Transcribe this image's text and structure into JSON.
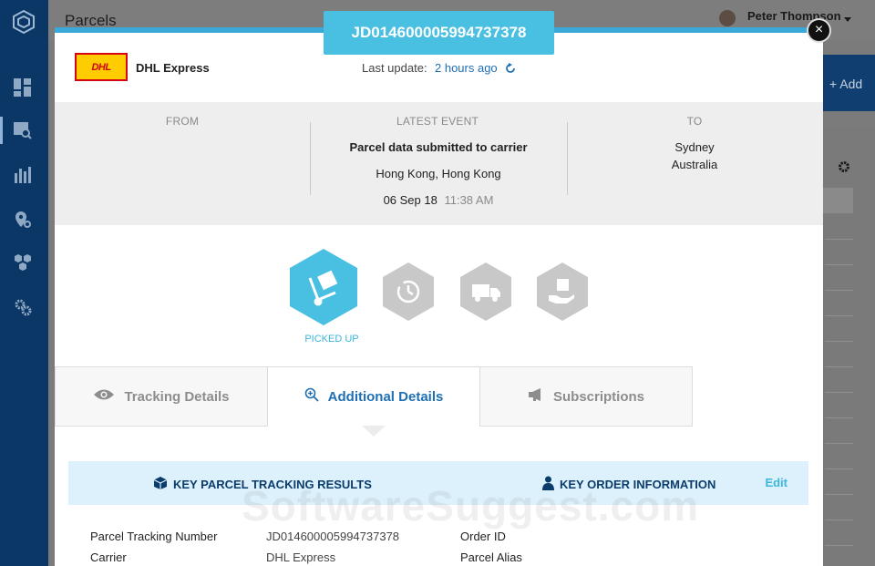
{
  "app": {
    "page_title": "Parcels",
    "user_name": "Peter Thompson",
    "add_label": "+ Add"
  },
  "modal": {
    "tracking_number": "JD014600005994737378",
    "carrier_logo_text": "DHL",
    "carrier_name": "DHL Express",
    "last_update_label": "Last update:",
    "last_update_value": "2 hours ago",
    "summary": {
      "from_label": "FROM",
      "latest_label": "LATEST EVENT",
      "to_label": "TO",
      "event_title": "Parcel data submitted to carrier",
      "event_location": "Hong Kong, Hong Kong",
      "event_date": "06 Sep 18",
      "event_time": "11:38 AM",
      "to_city": "Sydney",
      "to_country": "Australia"
    },
    "steps": [
      {
        "name": "picked-up",
        "label": "PICKED UP",
        "active": true
      },
      {
        "name": "in-transit",
        "label": "",
        "active": false
      },
      {
        "name": "out-for-delivery",
        "label": "",
        "active": false
      },
      {
        "name": "delivered",
        "label": "",
        "active": false
      }
    ],
    "tabs": [
      {
        "label": "Tracking Details",
        "icon": "eye-icon"
      },
      {
        "label": "Additional Details",
        "icon": "zoom-in-icon"
      },
      {
        "label": "Subscriptions",
        "icon": "megaphone-icon"
      }
    ],
    "results_bar": {
      "key_parcel": "KEY PARCEL TRACKING RESULTS",
      "key_order": "KEY ORDER INFORMATION",
      "edit": "Edit"
    },
    "details": {
      "tracking_number_label": "Parcel Tracking Number",
      "tracking_number_value": "JD014600005994737378",
      "carrier_label": "Carrier",
      "carrier_value": "DHL Express",
      "order_id_label": "Order ID",
      "parcel_alias_label": "Parcel Alias"
    },
    "watermark": "SoftwareSuggest.com"
  },
  "colors": {
    "sidebar": "#0b3766",
    "accent": "#49bfe2",
    "link": "#1f6fb3",
    "inactive_step": "#c8c8c8"
  }
}
